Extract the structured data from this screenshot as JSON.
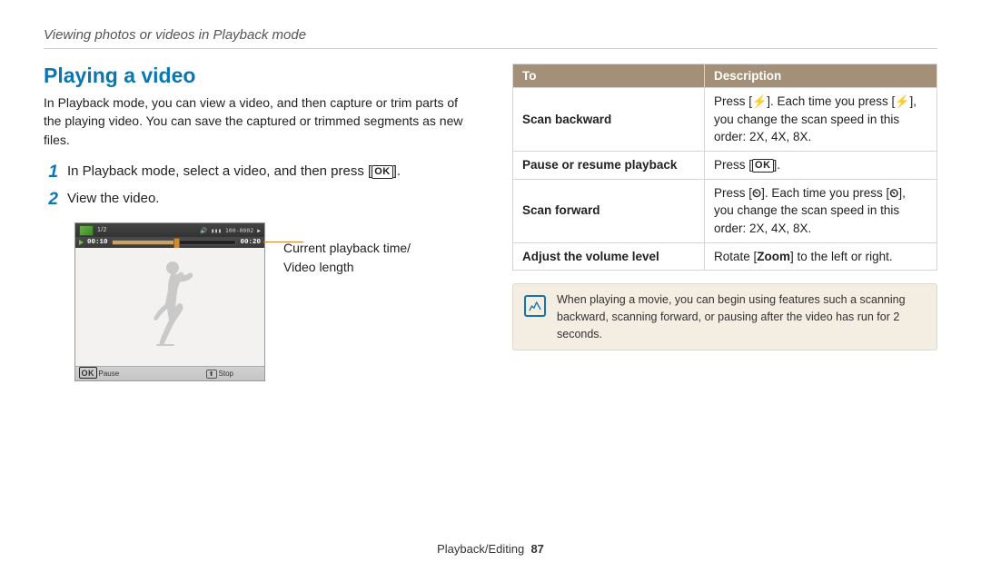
{
  "breadcrumb": "Viewing photos or videos in Playback mode",
  "section_title": "Playing a video",
  "intro": "In Playback mode, you can view a video, and then capture or trim parts of the playing video. You can save the captured or trimmed segments as new files.",
  "steps": {
    "one_num": "1",
    "one_pre": "In Playback mode, select a video, and then press [",
    "one_post": "].",
    "two_num": "2",
    "two_text": "View the video."
  },
  "thumb": {
    "time_current": "00:10",
    "time_total": "00:20",
    "top_half": "1/2",
    "top_right": "🔊 ▮▮▮ 100-0002 ▶",
    "pause_label": "Pause",
    "stop_label": "Stop",
    "annotation_l1": "Current playback time/",
    "annotation_l2": "Video length"
  },
  "table_headers": {
    "to": "To",
    "desc": "Description"
  },
  "rows": {
    "scan_back": {
      "label": "Scan backward",
      "d1": "Press [",
      "d2": "]. Each time you press [",
      "d3": "], you change the scan speed in this order: 2X, 4X, 8X."
    },
    "pause": {
      "label": "Pause or resume playback",
      "d1": "Press [",
      "d2": "]."
    },
    "scan_fwd": {
      "label": "Scan forward",
      "d1": "Press [",
      "d2": "]. Each time you press [",
      "d3": "], you change the scan speed in this order: 2X, 4X, 8X."
    },
    "volume": {
      "label": "Adjust the volume level",
      "d1": "Rotate [",
      "zoom": "Zoom",
      "d2": "] to the left or right."
    }
  },
  "note": "When playing a movie, you can begin using features such a scanning backward, scanning forward, or pausing after the video has run for 2 seconds.",
  "footer_section": "Playback/Editing",
  "footer_page": "87",
  "icons": {
    "ok": "OK",
    "flash": "⚡",
    "timer": "⏲"
  }
}
